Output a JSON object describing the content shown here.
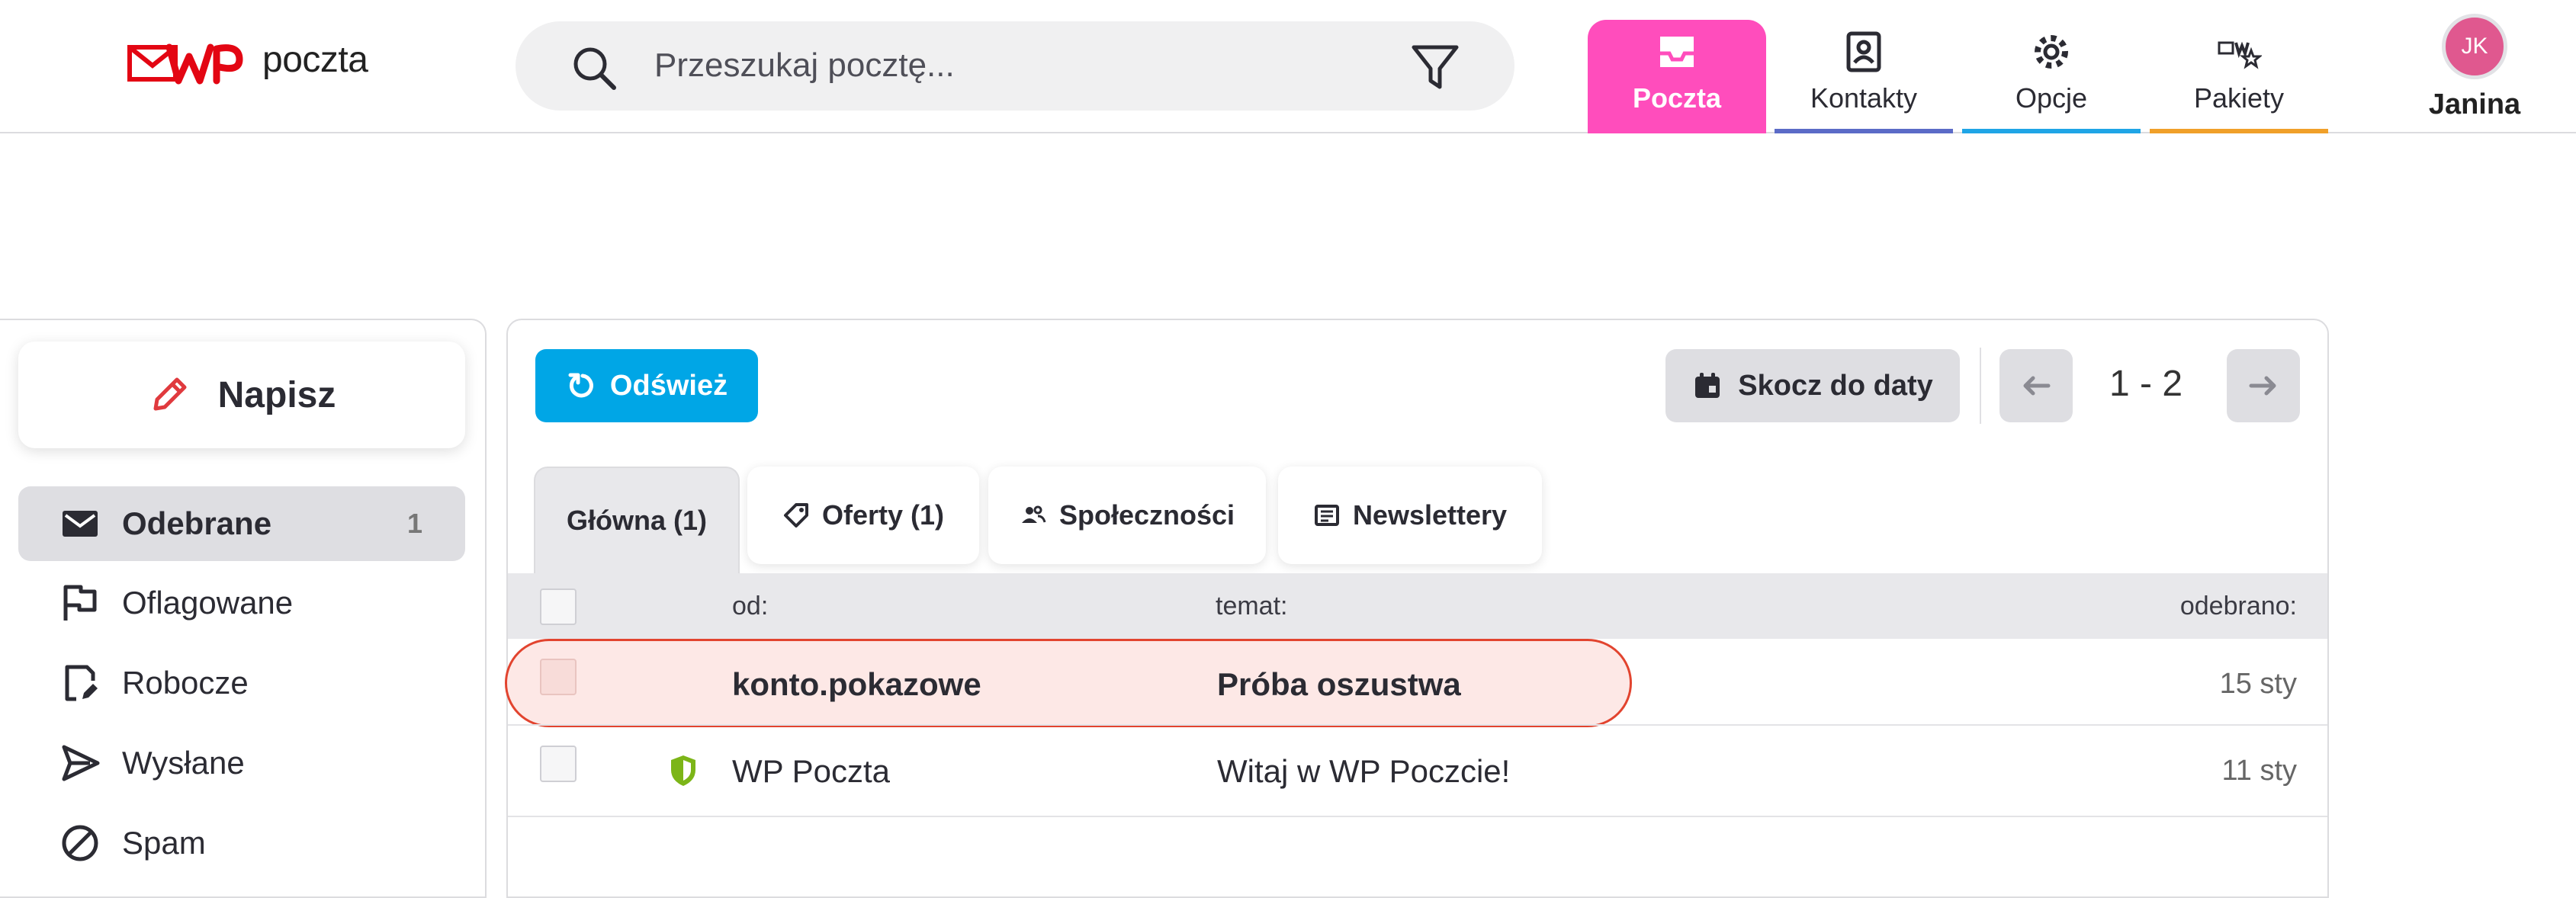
{
  "header": {
    "logo_text": "poczta",
    "search_placeholder": "Przeszukaj pocztę...",
    "nav": [
      {
        "label": "Poczta",
        "icon": "inbox-icon",
        "active": true
      },
      {
        "label": "Kontakty",
        "icon": "contacts-icon",
        "color": "#5b6bc7"
      },
      {
        "label": "Opcje",
        "icon": "gear-icon",
        "color": "#1fa5e6"
      },
      {
        "label": "Pakiety",
        "icon": "packages-icon",
        "color": "#f0a02a"
      }
    ],
    "user": {
      "initials": "JK",
      "name": "Janina"
    }
  },
  "sidebar": {
    "compose_label": "Napisz",
    "folders": [
      {
        "label": "Odebrane",
        "icon": "envelope-icon",
        "count": "1",
        "active": true
      },
      {
        "label": "Oflagowane",
        "icon": "flag-icon"
      },
      {
        "label": "Robocze",
        "icon": "draft-icon"
      },
      {
        "label": "Wysłane",
        "icon": "send-icon"
      },
      {
        "label": "Spam",
        "icon": "spam-icon"
      }
    ]
  },
  "toolbar": {
    "refresh_label": "Odśwież",
    "jump_label": "Skocz do daty",
    "page_range": "1 - 2"
  },
  "tabs": [
    {
      "label": "Główna (1)",
      "active": true
    },
    {
      "label": "Oferty (1)",
      "icon": "tag-icon"
    },
    {
      "label": "Społeczności",
      "icon": "people-icon"
    },
    {
      "label": "Newslettery",
      "icon": "newspaper-icon"
    }
  ],
  "table": {
    "columns": {
      "from": "od:",
      "subject": "temat:",
      "received": "odebrano:"
    },
    "rows": [
      {
        "from": "konto.pokazowe",
        "subject": "Próba oszustwa",
        "date": "15 sty",
        "unread": true,
        "highlighted": true
      },
      {
        "from": "WP Poczta",
        "subject": "Witaj w WP Poczcie!",
        "date": "11 sty",
        "verified": true
      }
    ]
  },
  "colors": {
    "accent_pink": "#ff4dbc",
    "refresh_blue": "#00a6e6",
    "highlight_red": "#e2442f",
    "logo_red": "#e30613",
    "verified_green": "#7cb518"
  }
}
